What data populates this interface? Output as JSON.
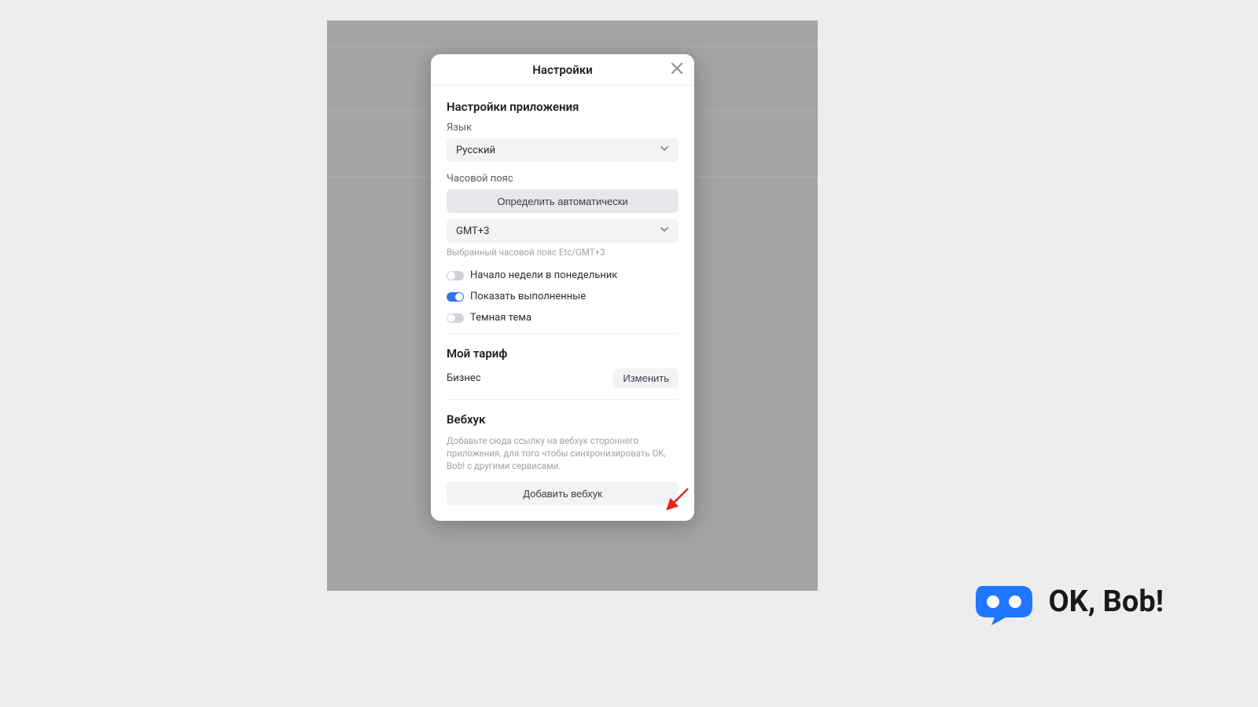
{
  "modal": {
    "title": "Настройки",
    "app_settings_title": "Настройки приложения",
    "language_label": "Язык",
    "language_value": "Русский",
    "timezone_label": "Часовой пояс",
    "detect_auto_button": "Определить автоматически",
    "timezone_value": "GMT+3",
    "timezone_hint": "Выбранный часовой пояс Etc/GMT+3",
    "toggle_week_start": "Начало недели в понедельник",
    "toggle_show_completed": "Показать выполненные",
    "toggle_dark_theme": "Темная тема",
    "plan_section_title": "Мой тариф",
    "plan_name": "Бизнес",
    "plan_change_button": "Изменить",
    "webhook_section_title": "Вебхук",
    "webhook_hint": "Добавьте сюда ссылку на вебхук стороннего приложения, для того чтобы синхронизировать OK, Bob! с другими сервисами.",
    "webhook_add_button": "Добавить вебхук"
  },
  "logo": {
    "text": "OK, Bob!"
  }
}
